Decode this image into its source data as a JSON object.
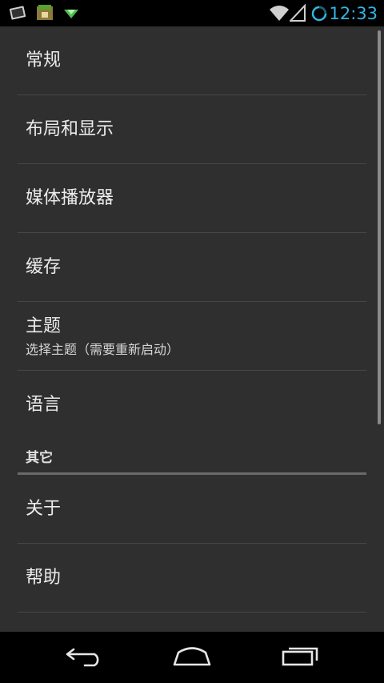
{
  "status_bar": {
    "time": "12:33",
    "notification_icons": [
      "screenshot-icon",
      "android-app-icon",
      "download-arrow-icon"
    ],
    "status_icons": [
      "wifi-icon",
      "signal-icon",
      "sync-progress-icon"
    ],
    "accent_color": "#33b5e5"
  },
  "preferences": {
    "items": [
      {
        "title": "常规"
      },
      {
        "title": "布局和显示"
      },
      {
        "title": "媒体播放器"
      },
      {
        "title": "缓存"
      },
      {
        "title": "主题",
        "summary": "选择主题（需要重新启动）"
      },
      {
        "title": "语言"
      }
    ],
    "category_other": {
      "label": "其它",
      "items": [
        {
          "title": "关于"
        },
        {
          "title": "帮助"
        }
      ]
    }
  },
  "nav_bar": {
    "buttons": [
      "back-icon",
      "home-icon",
      "recent-apps-icon"
    ]
  }
}
